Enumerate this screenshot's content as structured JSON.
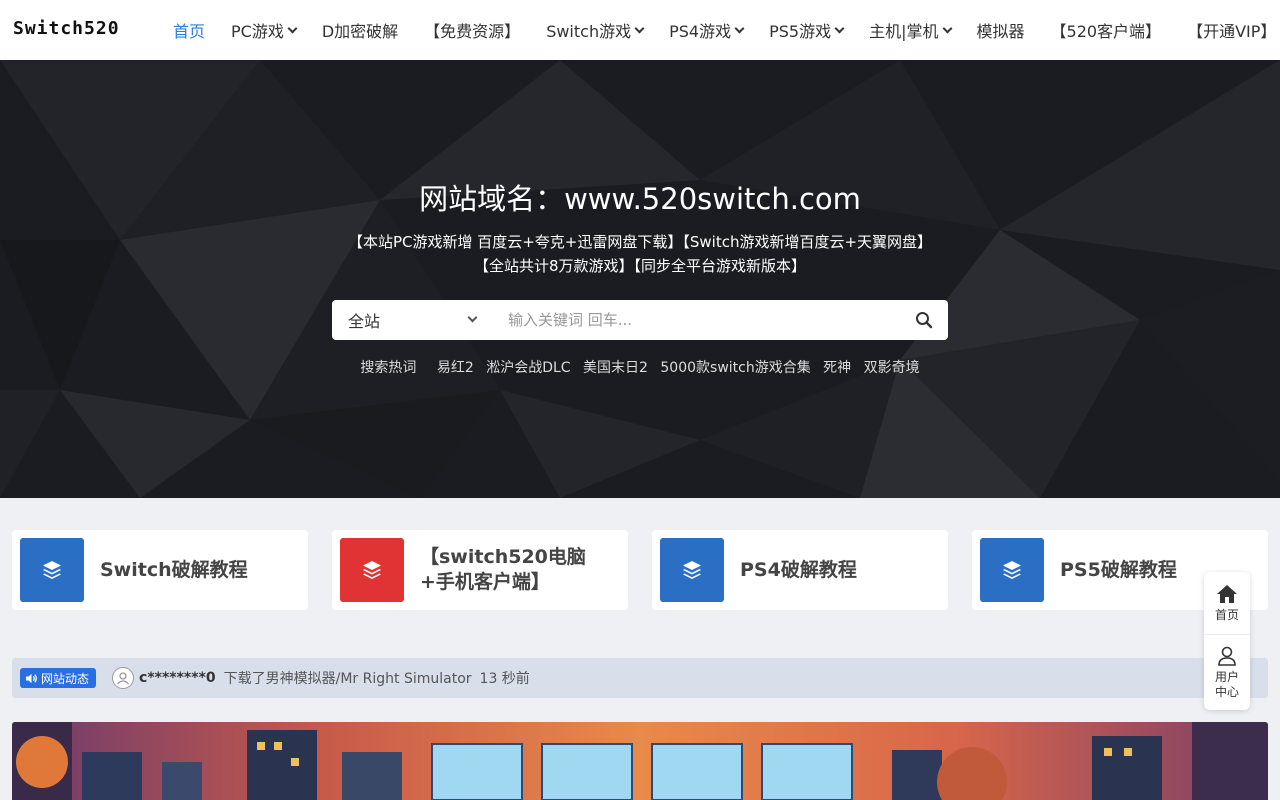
{
  "header": {
    "logo": "Switch520",
    "nav": [
      {
        "label": "首页",
        "active": true,
        "dropdown": false
      },
      {
        "label": "PC游戏",
        "active": false,
        "dropdown": true
      },
      {
        "label": "D加密破解",
        "active": false,
        "dropdown": false
      },
      {
        "label": "【免费资源】",
        "active": false,
        "dropdown": false
      },
      {
        "label": "Switch游戏",
        "active": false,
        "dropdown": true
      },
      {
        "label": "PS4游戏",
        "active": false,
        "dropdown": true
      },
      {
        "label": "PS5游戏",
        "active": false,
        "dropdown": true
      },
      {
        "label": "主机|掌机",
        "active": false,
        "dropdown": true
      },
      {
        "label": "模拟器",
        "active": false,
        "dropdown": false
      },
      {
        "label": "【520客户端】",
        "active": false,
        "dropdown": false
      },
      {
        "label": "【开通VIP】",
        "active": false,
        "dropdown": false
      }
    ]
  },
  "hero": {
    "title": "网站域名：www.520switch.com",
    "subtitle": "【本站PC游戏新增 百度云+夸克+迅雷网盘下载】【Switch游戏新增百度云+天翼网盘】【全站共计8万款游戏】【同步全平台游戏新版本】",
    "search": {
      "scope": "全站",
      "placeholder": "输入关键词 回车..."
    },
    "hot_label": "搜索热词",
    "hot_tags": [
      "易红2",
      "淞沪会战DLC",
      "美国末日2",
      "5000款switch游戏合集",
      "死神",
      "双影奇境"
    ]
  },
  "cards": [
    {
      "title": "Switch破解教程",
      "icon": "layers-icon",
      "color": "#2a6fc4"
    },
    {
      "title": "【switch520电脑+手机客户端】",
      "icon": "layers-icon",
      "color": "#e03434"
    },
    {
      "title": "PS4破解教程",
      "icon": "layers-icon",
      "color": "#2a6fc4"
    },
    {
      "title": "PS5破解教程",
      "icon": "layers-icon",
      "color": "#2a6fc4"
    }
  ],
  "activity": {
    "badge": "网站动态",
    "user": "c********0",
    "text": "下载了男神模拟器/Mr Right Simulator",
    "time": "13 秒前"
  },
  "float_menu": [
    {
      "label": "首页",
      "icon": "home-icon"
    },
    {
      "label": "用户中心",
      "icon": "user-icon"
    }
  ],
  "colors": {
    "accent": "#2a7be4",
    "hero_bg": "#1a1b20",
    "card_blue": "#2a6fc4",
    "card_red": "#e03434",
    "badge_blue": "#2a6fe0"
  }
}
